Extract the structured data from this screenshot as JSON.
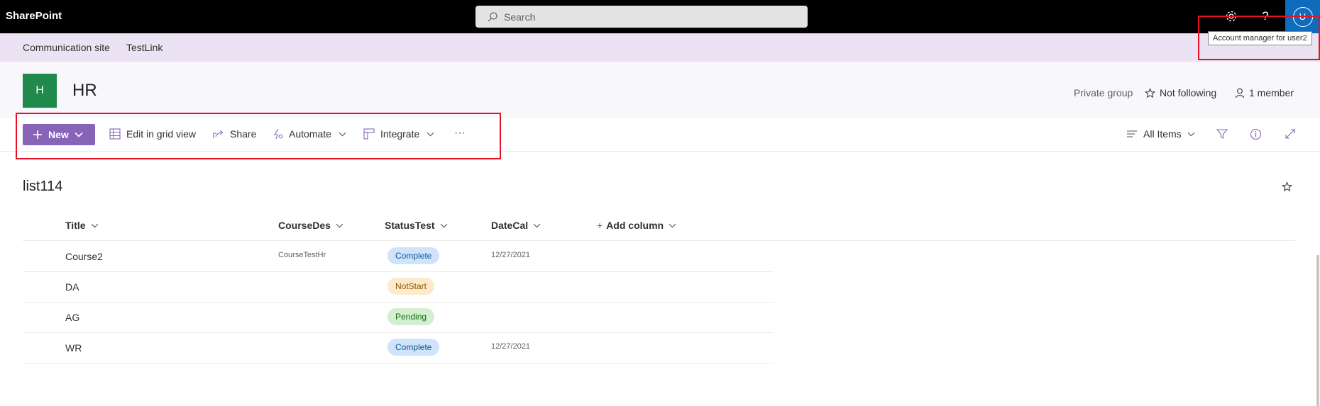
{
  "suitebar": {
    "brand": "SharePoint",
    "search_placeholder": "Search",
    "icons": [
      "settings-icon",
      "help-icon"
    ],
    "avatar_initial": "U"
  },
  "tooltip": {
    "text": "Account manager for user2"
  },
  "hubnav": {
    "items": [
      "Communication site",
      "TestLink"
    ]
  },
  "site": {
    "logo_letter": "H",
    "title": "HR",
    "privacy": "Private group",
    "follow": "Not following",
    "members": "1 member"
  },
  "commandbar": {
    "new": "New",
    "edit_grid": "Edit in grid view",
    "share": "Share",
    "automate": "Automate",
    "integrate": "Integrate",
    "view": "All Items"
  },
  "list": {
    "title": "list114",
    "columns": [
      "Title",
      "CourseDes",
      "StatusTest",
      "DateCal",
      "Add column"
    ],
    "rows": [
      {
        "title": "Course2",
        "coursedes": "CourseTestHr",
        "status": "Complete",
        "date": "12/27/2021"
      },
      {
        "title": "DA",
        "coursedes": "",
        "status": "NotStart",
        "date": ""
      },
      {
        "title": "AG",
        "coursedes": "",
        "status": "Pending",
        "date": ""
      },
      {
        "title": "WR",
        "coursedes": "",
        "status": "Complete",
        "date": "12/27/2021"
      }
    ]
  },
  "colors": {
    "suitebar": "#000000",
    "hubnav": "#ebe3f3",
    "accent": "#8764b8",
    "site_logo": "#1f8a4c",
    "avatar_bg": "#0f6cbd",
    "pill_complete": "#cfe4fa",
    "pill_notstart": "#fdeacb",
    "pill_pending": "#d3efd0",
    "highlight": "#e81123"
  }
}
